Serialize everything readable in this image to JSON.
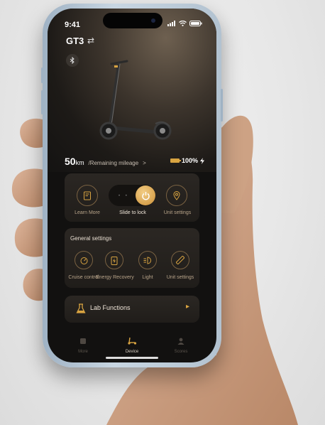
{
  "status_bar": {
    "time": "9:41"
  },
  "device": {
    "model": "GT3",
    "swap_icon": "swap-icon",
    "bluetooth_icon": "bluetooth-icon"
  },
  "mileage": {
    "value": "50",
    "unit": "km",
    "label": "/Remaining mileage",
    "chevron": ">"
  },
  "battery": {
    "percent": "100%",
    "level": 1.0,
    "charging_icon": "lightning-icon",
    "color": "#d9a441"
  },
  "controls": {
    "learn_more": "Learn More",
    "slide_to_lock": "Slide to lock",
    "unit_settings": "Unit settings"
  },
  "general_settings": {
    "title": "General settings",
    "items": [
      {
        "label": "Cruise control",
        "icon": "cruise-control-icon"
      },
      {
        "label": "Energy Recovery",
        "icon": "energy-recovery-icon"
      },
      {
        "label": "Light",
        "icon": "light-icon"
      },
      {
        "label": "Unit settings",
        "icon": "ruler-icon"
      }
    ]
  },
  "lab": {
    "label": "Lab Functions",
    "icon": "flask-icon"
  },
  "tabs": [
    {
      "label": "More",
      "icon": "grid-icon",
      "active": false
    },
    {
      "label": "Device",
      "icon": "scooter-icon",
      "active": true
    },
    {
      "label": "Scores",
      "icon": "person-icon",
      "active": false
    }
  ],
  "colors": {
    "accent": "#d9a441",
    "background": "#121110",
    "card": "#26231f"
  }
}
